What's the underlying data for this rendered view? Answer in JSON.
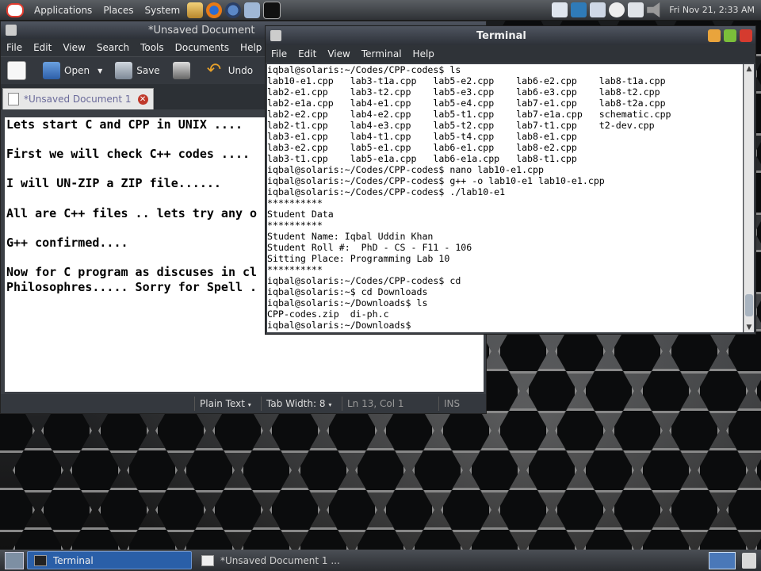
{
  "top_panel": {
    "menus": [
      "Applications",
      "Places",
      "System"
    ],
    "clock": "Fri Nov 21,  2:33 AM"
  },
  "gedit": {
    "title": "*Unsaved Document",
    "menus": [
      "File",
      "Edit",
      "View",
      "Search",
      "Tools",
      "Documents",
      "Help"
    ],
    "toolbar": {
      "open": "Open",
      "save": "Save",
      "undo": "Undo"
    },
    "tab_label": "*Unsaved Document 1",
    "lines": [
      "Lets start C and CPP in UNIX ....",
      "",
      "First we will check C++ codes ....",
      "",
      "I will UN-ZIP a ZIP file......",
      "",
      "All are C++ files .. lets try any o",
      "",
      "G++ confirmed....",
      "",
      "Now for C program as discuses in cl",
      "Philosophres..... Sorry for Spell ."
    ],
    "status": {
      "mode": "Plain Text",
      "tab_width": "Tab Width: 8",
      "position": "Ln 13, Col 1",
      "ins": "INS"
    }
  },
  "terminal": {
    "title": "Terminal",
    "menus": [
      "File",
      "Edit",
      "View",
      "Terminal",
      "Help"
    ],
    "lines": [
      "iqbal@solaris:~/Codes/CPP-codes$ ls",
      "lab10-e1.cpp   lab3-t1a.cpp   lab5-e2.cpp    lab6-e2.cpp    lab8-t1a.cpp",
      "lab2-e1.cpp    lab3-t2.cpp    lab5-e3.cpp    lab6-e3.cpp    lab8-t2.cpp",
      "lab2-e1a.cpp   lab4-e1.cpp    lab5-e4.cpp    lab7-e1.cpp    lab8-t2a.cpp",
      "lab2-e2.cpp    lab4-e2.cpp    lab5-t1.cpp    lab7-e1a.cpp   schematic.cpp",
      "lab2-t1.cpp    lab4-e3.cpp    lab5-t2.cpp    lab7-t1.cpp    t2-dev.cpp",
      "lab3-e1.cpp    lab4-t1.cpp    lab5-t4.cpp    lab8-e1.cpp",
      "lab3-e2.cpp    lab5-e1.cpp    lab6-e1.cpp    lab8-e2.cpp",
      "lab3-t1.cpp    lab5-e1a.cpp   lab6-e1a.cpp   lab8-t1.cpp",
      "iqbal@solaris:~/Codes/CPP-codes$ nano lab10-e1.cpp",
      "iqbal@solaris:~/Codes/CPP-codes$ g++ -o lab10-e1 lab10-e1.cpp",
      "iqbal@solaris:~/Codes/CPP-codes$ ./lab10-e1",
      "**********",
      "Student Data",
      "**********",
      "Student Name: Iqbal Uddin Khan",
      "Student Roll #:  PhD - CS - F11 - 106",
      "Sitting Place: Programming Lab 10",
      "**********",
      "iqbal@solaris:~/Codes/CPP-codes$ cd",
      "iqbal@solaris:~$ cd Downloads",
      "iqbal@solaris:~/Downloads$ ls",
      "CPP-codes.zip  di-ph.c",
      "iqbal@solaris:~/Downloads$"
    ]
  },
  "taskbar": {
    "tasks": [
      "Terminal",
      "*Unsaved Document 1 ..."
    ]
  }
}
